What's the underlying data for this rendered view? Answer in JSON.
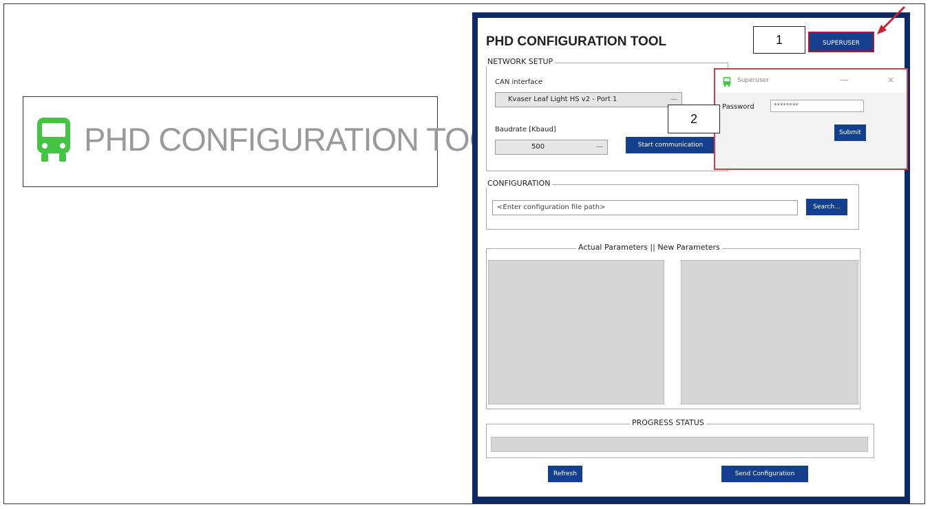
{
  "logo": {
    "text": "PHD CONFIGURATION TOOL",
    "icon": "bus-icon",
    "icon_color": "#43c443"
  },
  "app": {
    "title": "PHD CONFIGURATION TOOL",
    "superuser_label": "SUPERUSER",
    "network_setup": {
      "title": "NETWORK SETUP",
      "can_label": "CAN interface",
      "can_value": "Kvaser Leaf Light HS v2 - Port 1",
      "baud_label": "Baudrate [Kbaud]",
      "baud_value": "500",
      "start_label": "Start communication"
    },
    "configuration": {
      "title": "CONFIGURATION",
      "path_placeholder": "<Enter configuration file path>",
      "search_label": "Search..."
    },
    "parameters_title": "Actual Parameters || New Parameters",
    "progress_title": "PROGRESS STATUS",
    "refresh_label": "Refresh",
    "send_label": "Send Configuration"
  },
  "popup": {
    "title": "Superuser",
    "minimize": "—",
    "close": "×",
    "password_label": "Password",
    "password_value": "********",
    "submit_label": "Submit"
  },
  "callouts": [
    "1",
    "2"
  ],
  "colors": {
    "accent": "#143f8f",
    "frame": "#0d2a66",
    "highlight": "#d63a45"
  }
}
